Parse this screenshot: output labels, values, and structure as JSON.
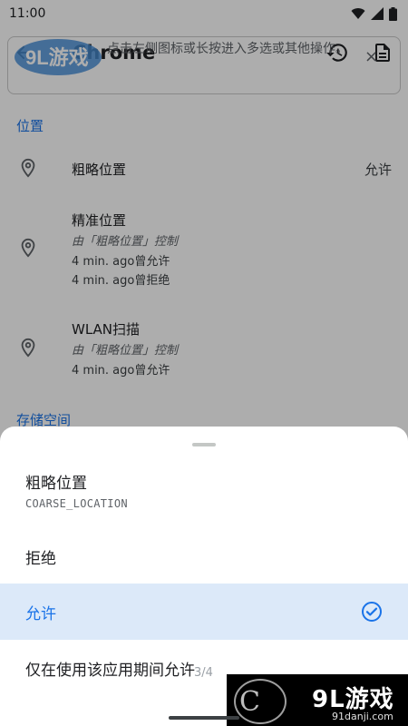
{
  "status_bar": {
    "time": "11:00"
  },
  "app_bar": {
    "title": "Chrome"
  },
  "hint": {
    "text": "点击左侧图标或长按进入多选或其他操作。",
    "close": "×"
  },
  "watermark": {
    "brand": "9L游戏",
    "domain": "91danji.com",
    "logo_letter": "C"
  },
  "section_location": "位置",
  "permissions": [
    {
      "name": "粗略位置",
      "value": "允许"
    },
    {
      "name": "精准位置",
      "sub": "由「粗略位置」控制",
      "history": [
        "4 min. ago曾允许",
        "4 min. ago曾拒绝"
      ]
    },
    {
      "name": "WLAN扫描",
      "sub": "由「粗略位置」控制",
      "history": [
        "4 min. ago曾允许"
      ]
    }
  ],
  "section_storage": "存储空间",
  "sheet": {
    "title": "粗略位置",
    "code": "COARSE_LOCATION",
    "options": [
      "拒绝",
      "允许",
      "仅在使用该应用期间允许"
    ],
    "selected_index": 1
  },
  "pager": "3/4",
  "colors": {
    "accent": "#1a73e8",
    "selected_bg": "#dce9f9",
    "scrim": "rgba(0,0,0,0.32)"
  },
  "icons": [
    "back-arrow-icon",
    "history-icon",
    "document-icon",
    "location-pin-icon",
    "check-circle-icon",
    "wifi-icon",
    "signal-icon",
    "battery-icon"
  ]
}
